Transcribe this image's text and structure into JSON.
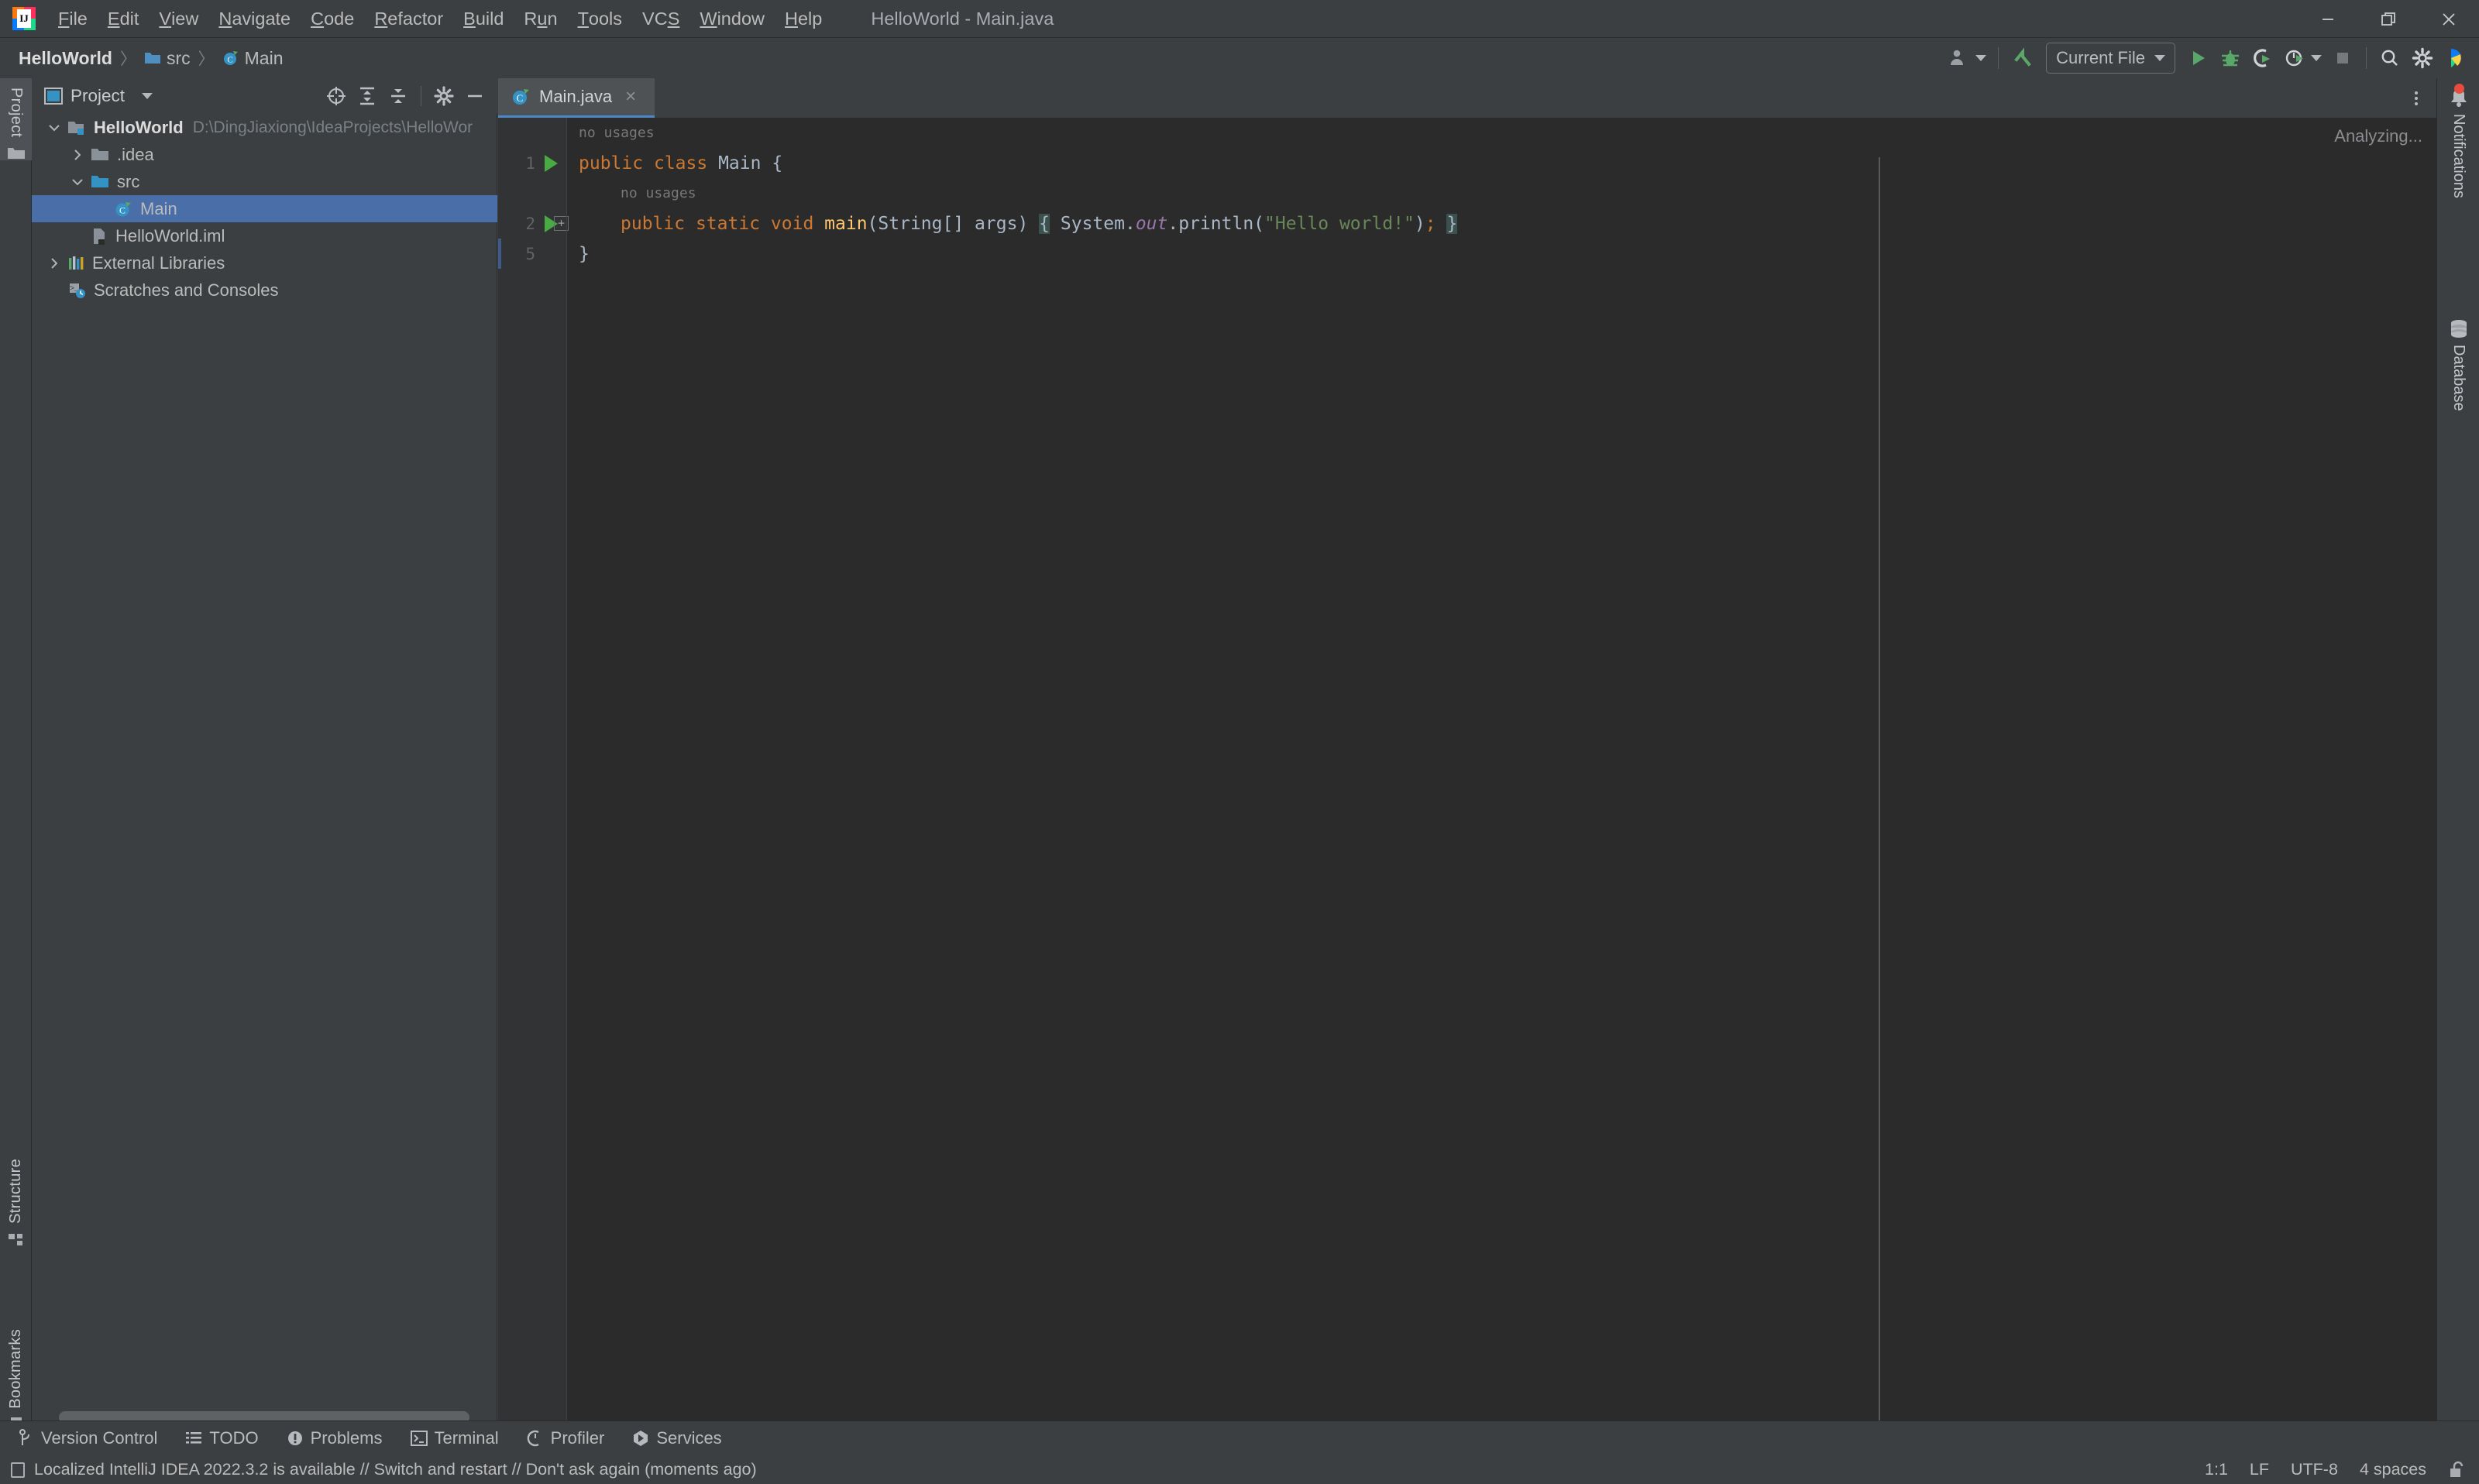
{
  "window": {
    "title": "HelloWorld - Main.java",
    "controls": {
      "minimize": "minimize-icon",
      "maximize": "restore-icon",
      "close": "close-icon"
    }
  },
  "menubar": {
    "items": [
      {
        "label": "File",
        "mnemonic": "F"
      },
      {
        "label": "Edit",
        "mnemonic": "E"
      },
      {
        "label": "View",
        "mnemonic": "V"
      },
      {
        "label": "Navigate",
        "mnemonic": "N"
      },
      {
        "label": "Code",
        "mnemonic": "C"
      },
      {
        "label": "Refactor",
        "mnemonic": "R"
      },
      {
        "label": "Build",
        "mnemonic": "B"
      },
      {
        "label": "Run",
        "mnemonic": "u"
      },
      {
        "label": "Tools",
        "mnemonic": "T"
      },
      {
        "label": "VCS",
        "mnemonic": "S"
      },
      {
        "label": "Window",
        "mnemonic": "W"
      },
      {
        "label": "Help",
        "mnemonic": "H"
      }
    ]
  },
  "navbar": {
    "breadcrumbs": [
      {
        "label": "HelloWorld",
        "icon": "project-icon",
        "bold": true
      },
      {
        "label": "src",
        "icon": "folder-icon",
        "bold": false
      },
      {
        "label": "Main",
        "icon": "java-class-icon",
        "bold": false
      }
    ],
    "toolbar": {
      "account": "account-icon",
      "updates": "updates-arrow-icon",
      "run_config": "Current File",
      "run": "run-icon",
      "debug": "debug-icon",
      "run_with_coverage": "run-coverage-icon",
      "profiler": "profiler-icon",
      "stop": "stop-icon",
      "search": "search-everywhere-icon",
      "settings": "settings-gear-icon",
      "ai_assistant": "ide-feature-icon"
    }
  },
  "left_stripe": {
    "top": [
      {
        "label": "Project",
        "icon": "project-folder-icon",
        "active": true
      }
    ],
    "bottom": [
      {
        "label": "Structure",
        "icon": "structure-icon"
      },
      {
        "label": "Bookmarks",
        "icon": "bookmark-icon"
      }
    ]
  },
  "project_panel": {
    "title": "Project",
    "tools": [
      {
        "name": "scroll-from-source-icon"
      },
      {
        "name": "expand-all-icon"
      },
      {
        "name": "collapse-all-icon"
      },
      {
        "name": "settings-gear-icon"
      },
      {
        "name": "hide-icon"
      }
    ],
    "tree": [
      {
        "label": "HelloWorld",
        "path": "D:\\DingJiaxiong\\IdeaProjects\\HelloWor",
        "depth": 0,
        "arrow": "down",
        "icon": "module-icon",
        "bold": true,
        "selected": false
      },
      {
        "label": ".idea",
        "path": "",
        "depth": 1,
        "arrow": "right",
        "icon": "folder-icon",
        "bold": false,
        "selected": false
      },
      {
        "label": "src",
        "path": "",
        "depth": 1,
        "arrow": "down",
        "icon": "source-folder-icon",
        "bold": false,
        "selected": false
      },
      {
        "label": "Main",
        "path": "",
        "depth": 2,
        "arrow": "none",
        "icon": "java-class-icon",
        "bold": false,
        "selected": true
      },
      {
        "label": "HelloWorld.iml",
        "path": "",
        "depth": 1,
        "arrow": "none",
        "icon": "iml-file-icon",
        "bold": false,
        "selected": false
      },
      {
        "label": "External Libraries",
        "path": "",
        "depth": 0,
        "arrow": "right",
        "icon": "libraries-icon",
        "bold": false,
        "selected": false
      },
      {
        "label": "Scratches and Consoles",
        "path": "",
        "depth": 0,
        "arrow": "none",
        "icon": "scratches-icon",
        "bold": false,
        "selected": false
      }
    ]
  },
  "editor": {
    "tabs": [
      {
        "label": "Main.java",
        "icon": "java-class-icon",
        "active": true,
        "close": "×"
      }
    ],
    "status_hint": "Analyzing...",
    "lines": [
      {
        "number": "",
        "kind": "hint",
        "text": "no usages",
        "indent": 0,
        "runmark": false,
        "fold": false
      },
      {
        "number": "1",
        "kind": "code",
        "indent": 0,
        "runmark": true,
        "fold": false,
        "tokens": [
          {
            "t": "public",
            "c": "kw"
          },
          {
            "t": " ",
            "c": "pln"
          },
          {
            "t": "class",
            "c": "kw"
          },
          {
            "t": " ",
            "c": "pln"
          },
          {
            "t": "Main",
            "c": "cls"
          },
          {
            "t": " ",
            "c": "pln"
          },
          {
            "t": "{",
            "c": "pln"
          }
        ]
      },
      {
        "number": "",
        "kind": "hint",
        "text": "no usages",
        "indent": 1,
        "runmark": false,
        "fold": false
      },
      {
        "number": "2",
        "kind": "code",
        "indent": 1,
        "runmark": true,
        "fold": true,
        "tokens": [
          {
            "t": "public",
            "c": "kw"
          },
          {
            "t": " ",
            "c": "pln"
          },
          {
            "t": "static",
            "c": "kw"
          },
          {
            "t": " ",
            "c": "pln"
          },
          {
            "t": "void",
            "c": "kw"
          },
          {
            "t": " ",
            "c": "pln"
          },
          {
            "t": "main",
            "c": "mth"
          },
          {
            "t": "(",
            "c": "pln"
          },
          {
            "t": "String",
            "c": "typ"
          },
          {
            "t": "[] ",
            "c": "pln"
          },
          {
            "t": "args",
            "c": "pln"
          },
          {
            "t": ")",
            "c": "pln"
          },
          {
            "t": " ",
            "c": "pln"
          },
          {
            "t": "{",
            "c": "brace-hl"
          },
          {
            "t": " ",
            "c": "pln"
          },
          {
            "t": "System",
            "c": "pln"
          },
          {
            "t": ".",
            "c": "pln"
          },
          {
            "t": "out",
            "c": "fld"
          },
          {
            "t": ".",
            "c": "pln"
          },
          {
            "t": "println",
            "c": "pln"
          },
          {
            "t": "(",
            "c": "pln"
          },
          {
            "t": "\"Hello world!\"",
            "c": "str"
          },
          {
            "t": ")",
            "c": "pln"
          },
          {
            "t": ";",
            "c": "kw"
          },
          {
            "t": " ",
            "c": "pln"
          },
          {
            "t": "}",
            "c": "brace-hl"
          }
        ]
      },
      {
        "number": "5",
        "kind": "code",
        "indent": 0,
        "runmark": false,
        "fold": false,
        "tokens": [
          {
            "t": "}",
            "c": "pln"
          }
        ]
      }
    ]
  },
  "right_stripe": {
    "items": [
      {
        "label": "Notifications",
        "icon": "bell-icon",
        "badge": true
      },
      {
        "label": "Database",
        "icon": "database-icon",
        "badge": false
      }
    ]
  },
  "bottom_bar": {
    "items": [
      {
        "label": "Version Control",
        "icon": "branch-icon"
      },
      {
        "label": "TODO",
        "icon": "todo-list-icon"
      },
      {
        "label": "Problems",
        "icon": "problems-icon"
      },
      {
        "label": "Terminal",
        "icon": "terminal-icon"
      },
      {
        "label": "Profiler",
        "icon": "profiler-icon"
      },
      {
        "label": "Services",
        "icon": "services-icon"
      }
    ]
  },
  "statusbar": {
    "message": "Localized IntelliJ IDEA 2022.3.2 is available // Switch and restart // Don't ask again (moments ago)",
    "message_icon": "ide-notification-icon",
    "caret_position": "1:1",
    "line_separator": "LF",
    "encoding": "UTF-8",
    "indent": "4 spaces",
    "lock": "unlocked-padlock-icon"
  },
  "colors": {
    "accent_blue": "#4a6fa8",
    "tab_underline": "#4a88c7",
    "keyword_orange": "#cc7832",
    "string_green": "#6a8759",
    "method_yellow": "#ffc66d",
    "field_purple": "#9876aa",
    "editor_bg": "#2b2b2b",
    "chrome_bg": "#3c3f41",
    "run_green": "#49a942",
    "badge_red": "#e74c3c"
  }
}
